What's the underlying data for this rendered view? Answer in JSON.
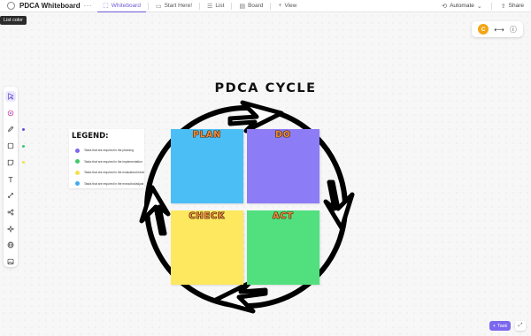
{
  "topbar": {
    "title": "PDCA Whiteboard",
    "more": "···",
    "tabs": [
      {
        "label": "Whiteboard",
        "icon": "whiteboard-icon"
      },
      {
        "label": "Start Here!",
        "icon": "doc-icon"
      },
      {
        "label": "List",
        "icon": "list-icon"
      },
      {
        "label": "Board",
        "icon": "board-icon"
      }
    ],
    "add_view": "View",
    "automate": "Automate",
    "share": "Share"
  },
  "tooltip": "List color",
  "top_right": {
    "avatar": "C"
  },
  "board": {
    "title": "PDCA CYCLE",
    "legend": {
      "title": "LEGEND:",
      "items": [
        {
          "text": "Tasks that are required in the planning",
          "color": "#7b68ee"
        },
        {
          "text": "Tasks that are required in the implementation",
          "color": "#3ec96a"
        },
        {
          "text": "Tasks that are required in the evaluation/check",
          "color": "#f4e04d"
        },
        {
          "text": "Tasks that are required in the execution/adjust",
          "color": "#3fa9f5"
        }
      ]
    },
    "stickies": [
      {
        "label": "PLAN",
        "color": "#4bbef5"
      },
      {
        "label": "DO",
        "color": "#8c7cf5"
      },
      {
        "label": "CHECK",
        "color": "#fde85f"
      },
      {
        "label": "ACT",
        "color": "#52e07e"
      }
    ]
  },
  "bottom": {
    "task_label": "Task"
  },
  "toolbar_dot_colors": [
    "#5b4fd6",
    "#3ec96a",
    "#f4e04d"
  ]
}
